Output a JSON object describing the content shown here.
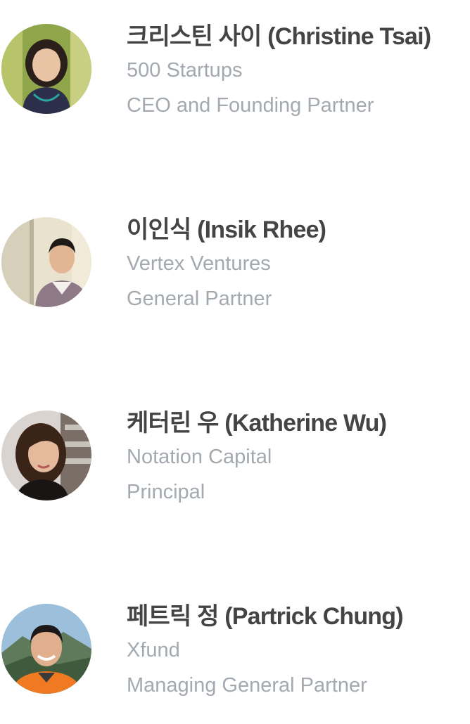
{
  "speakers": [
    {
      "name": "크리스틴 사이 (Christine Tsai)",
      "organization": "500 Startups",
      "role": "CEO and Founding Partner",
      "photo_icon": "person-photo"
    },
    {
      "name": "이인식 (Insik Rhee)",
      "organization": "Vertex Ventures",
      "role": "General Partner",
      "photo_icon": "person-photo"
    },
    {
      "name": "케터린 우 (Katherine Wu)",
      "organization": "Notation Capital",
      "role": "Principal",
      "photo_icon": "person-photo"
    },
    {
      "name": "페트릭 정 (Partrick Chung)",
      "organization": "Xfund",
      "role": "Managing General Partner",
      "photo_icon": "person-photo"
    }
  ],
  "colors": {
    "name_text": "#444444",
    "secondary_text": "#a3a9ae",
    "background": "#ffffff"
  }
}
